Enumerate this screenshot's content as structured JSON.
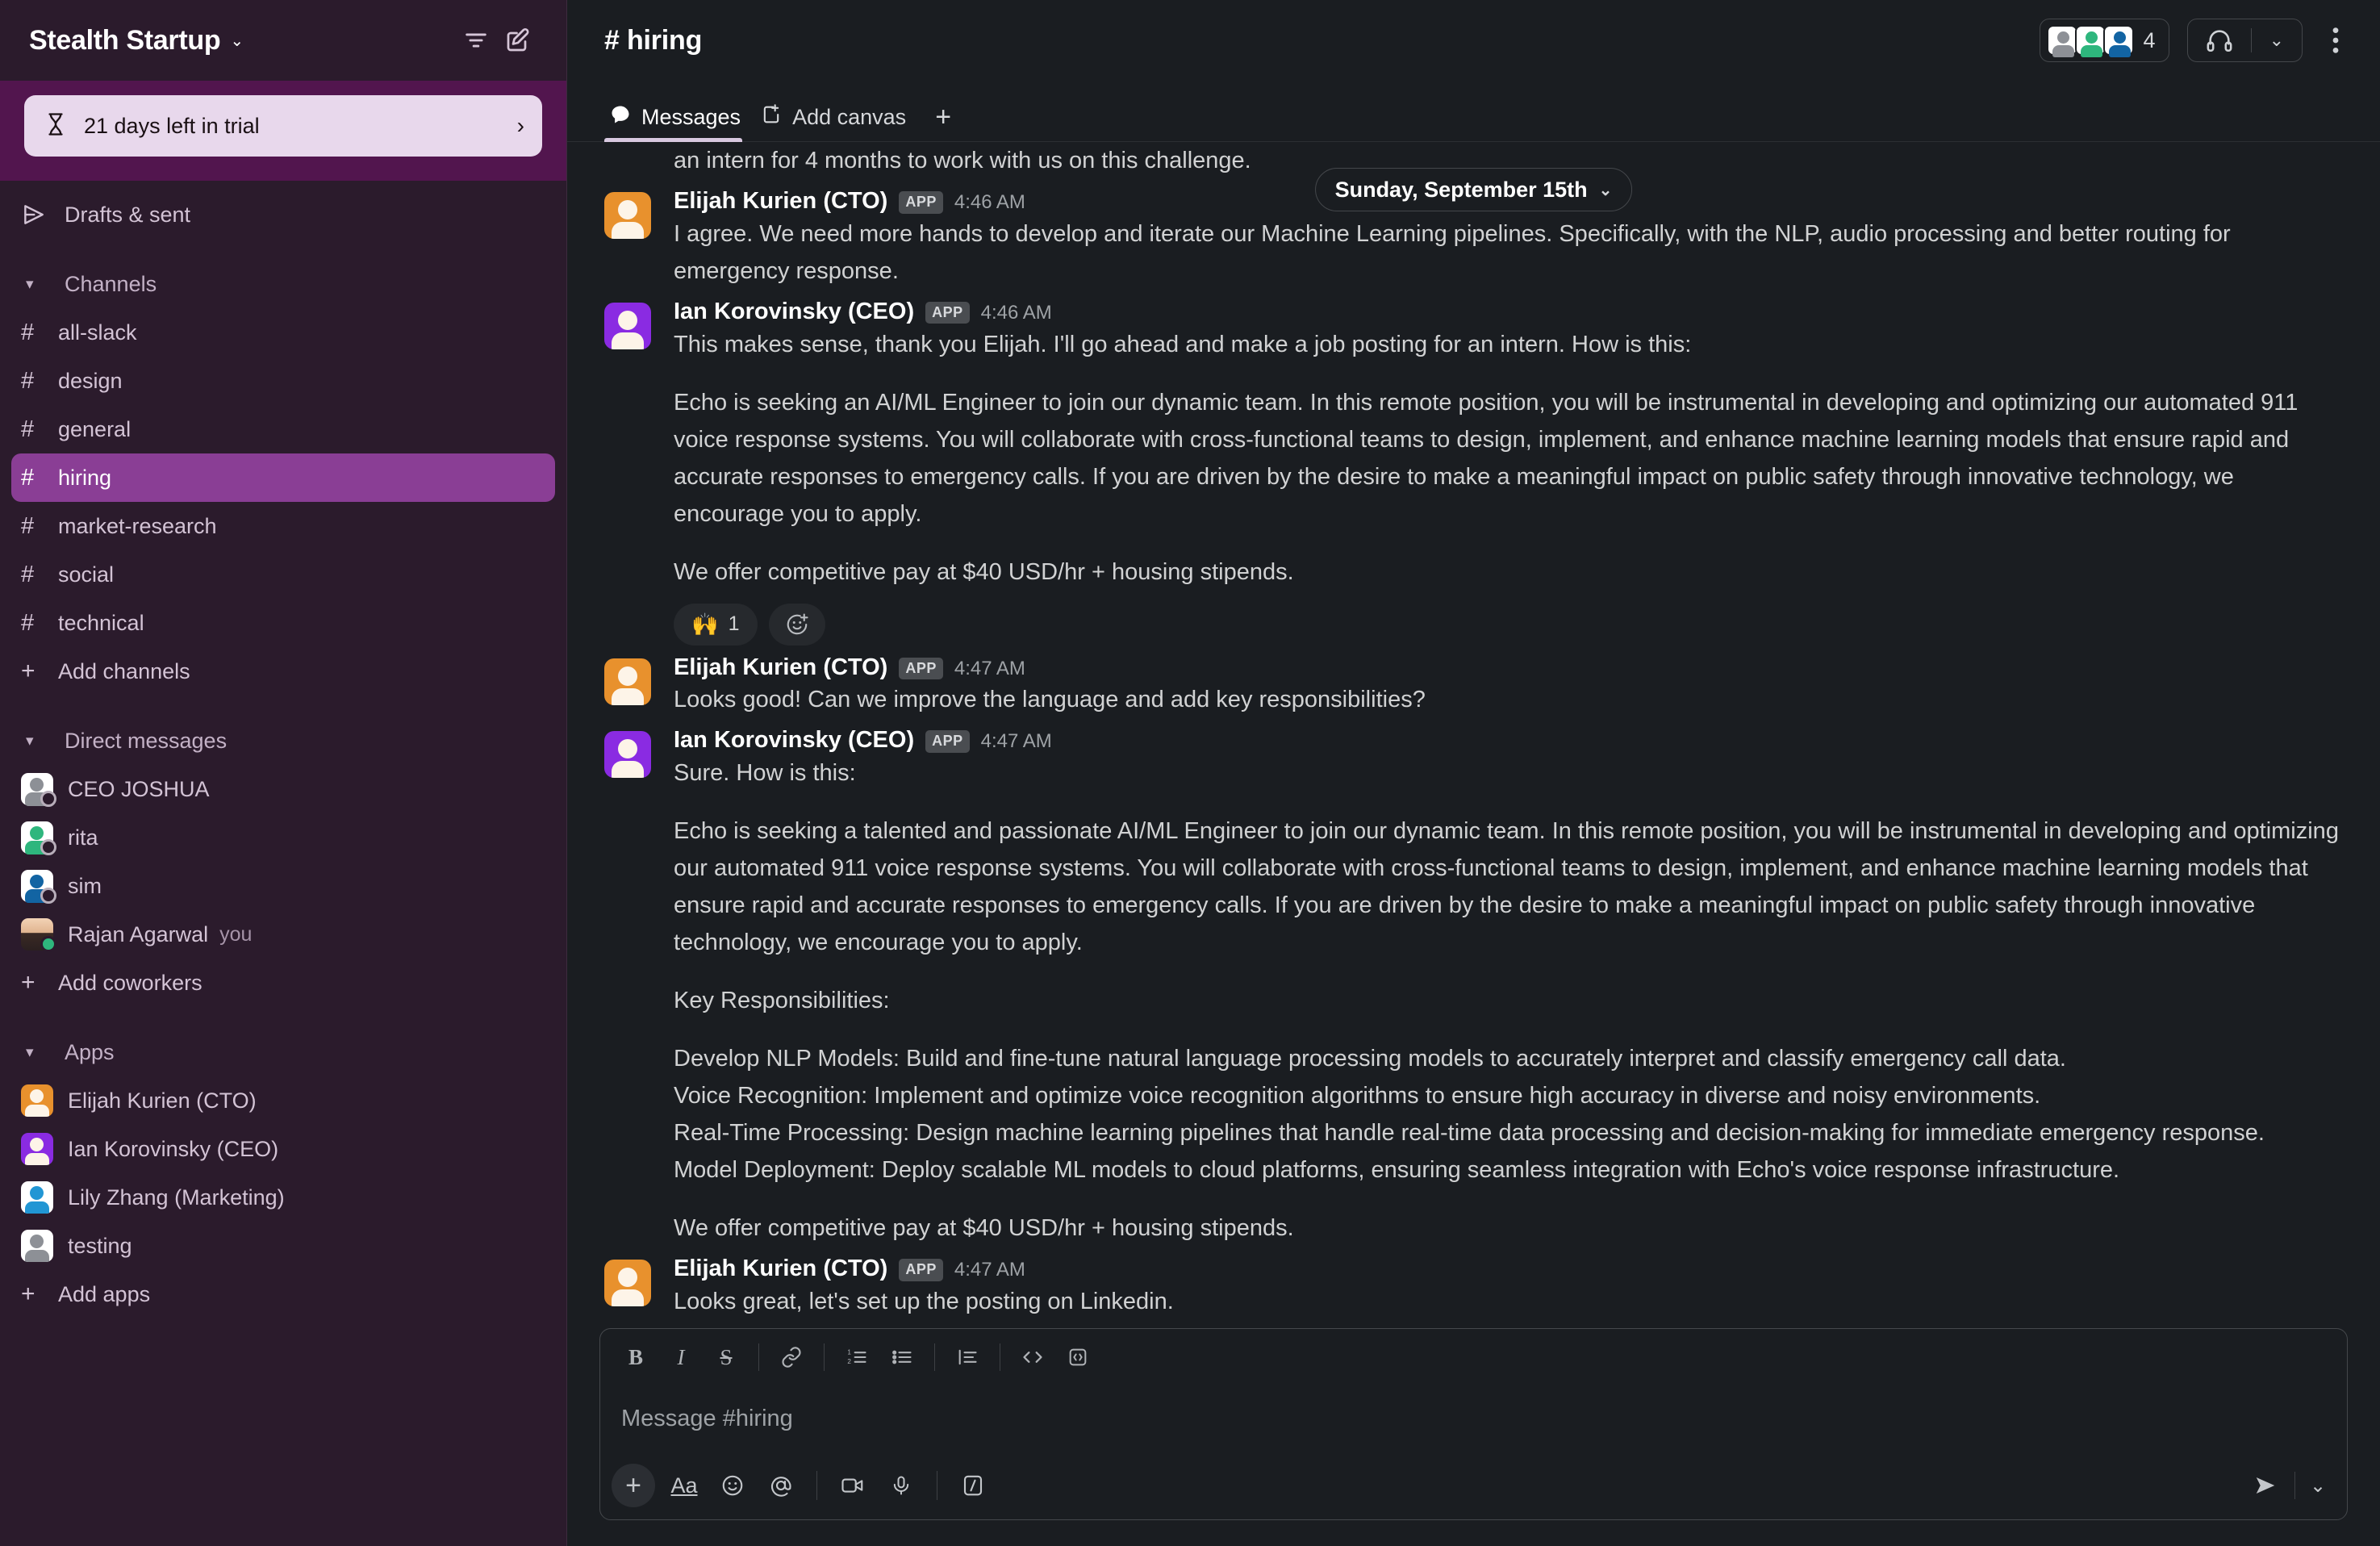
{
  "sidebar": {
    "workspace_name": "Stealth Startup",
    "workspace_caret": "⌄",
    "filter_icon": "filter-icon",
    "compose_icon": "compose-icon",
    "trial": {
      "icon": "hourglass-icon",
      "label": "21 days left in trial",
      "chevron": "›"
    },
    "drafts": {
      "label": "Drafts & sent",
      "icon": "paper-plane-icon"
    },
    "channels_section": {
      "label": "Channels",
      "caret": "▾",
      "items": [
        {
          "name": "all-slack",
          "active": false
        },
        {
          "name": "design",
          "active": false
        },
        {
          "name": "general",
          "active": false
        },
        {
          "name": "hiring",
          "active": true
        },
        {
          "name": "market-research",
          "active": false
        },
        {
          "name": "social",
          "active": false
        },
        {
          "name": "technical",
          "active": false
        }
      ],
      "add_label": "Add channels"
    },
    "dm_section": {
      "label": "Direct messages",
      "caret": "▾",
      "items": [
        {
          "name": "CEO JOSHUA",
          "color": "#8d9096",
          "presence": "away",
          "you": ""
        },
        {
          "name": "rita",
          "color": "#2eb67d",
          "presence": "away",
          "you": ""
        },
        {
          "name": "sim",
          "color": "#1264a3",
          "presence": "away",
          "you": ""
        },
        {
          "name": "Rajan Agarwal",
          "color": "#e8a87c",
          "presence": "online",
          "you": "you"
        }
      ],
      "add_label": "Add coworkers"
    },
    "apps_section": {
      "label": "Apps",
      "caret": "▾",
      "items": [
        {
          "name": "Elijah Kurien (CTO)",
          "color": "#e8912d"
        },
        {
          "name": "Ian Korovinsky (CEO)",
          "color": "#8a2be2"
        },
        {
          "name": "Lily Zhang (Marketing)",
          "color": "#2196d4"
        },
        {
          "name": "testing",
          "color": "#8d9096"
        }
      ],
      "add_label": "Add apps"
    }
  },
  "header": {
    "channel_title": "# hiring",
    "members_count": "4",
    "headphones_icon": "headphones-icon",
    "headphones_caret": "⌄",
    "kebab_icon": "more-options-icon",
    "face_colors": [
      "#8d9096",
      "#2eb67d",
      "#1264a3"
    ]
  },
  "tabs": {
    "items": [
      {
        "label": "Messages",
        "icon": "messages-icon",
        "active": true
      },
      {
        "label": "Add canvas",
        "icon": "canvas-icon",
        "active": false
      }
    ],
    "add_tab": "+"
  },
  "date_divider": {
    "label": "Sunday, September 15th",
    "caret": "⌄"
  },
  "scrolled_message_tail": "an intern for 4 months to work with us on this challenge.",
  "messages": [
    {
      "author": "Elijah Kurien (CTO)",
      "badge": "APP",
      "time": "4:46 AM",
      "avatar_color": "#e8912d",
      "paragraphs": [
        "I agree. We need more hands to develop and iterate our Machine Learning pipelines. Specifically, with the NLP, audio processing and better routing for emergency response."
      ],
      "reactions": []
    },
    {
      "author": "Ian Korovinsky (CEO)",
      "badge": "APP",
      "time": "4:46 AM",
      "avatar_color": "#8a2be2",
      "paragraphs": [
        "This makes sense, thank you Elijah. I'll go ahead and make a job posting for an intern. How is this:",
        "Echo is seeking an AI/ML Engineer to join our dynamic team. In this remote position, you will be instrumental in developing and optimizing our automated 911 voice response systems. You will collaborate with cross-functional teams to design, implement, and enhance machine learning models that ensure rapid and accurate responses to emergency calls. If you are driven by the desire to make a meaningful impact on public safety through innovative technology, we encourage you to apply.",
        "We offer competitive pay at $40 USD/hr + housing stipends."
      ],
      "reactions": [
        {
          "emoji": "🙌",
          "count": "1"
        }
      ],
      "add_reaction_icon": "add-reaction-icon"
    },
    {
      "author": "Elijah Kurien (CTO)",
      "badge": "APP",
      "time": "4:47 AM",
      "avatar_color": "#e8912d",
      "paragraphs": [
        "Looks good! Can we improve the language and add key responsibilities?"
      ],
      "reactions": []
    },
    {
      "author": "Ian Korovinsky (CEO)",
      "badge": "APP",
      "time": "4:47 AM",
      "avatar_color": "#8a2be2",
      "paragraphs": [
        "Sure. How is this:",
        "Echo is seeking a talented and passionate AI/ML Engineer to join our dynamic team. In this remote position, you will be instrumental in developing and optimizing our automated 911 voice response systems. You will collaborate with cross-functional teams to design, implement, and enhance machine learning models that ensure rapid and accurate responses to emergency calls. If you are driven by the desire to make a meaningful impact on public safety through innovative technology, we encourage you to apply.",
        "Key Responsibilities:"
      ],
      "responsibilities": [
        "Develop NLP Models: Build and fine-tune natural language processing models to accurately interpret and classify emergency call data.",
        "Voice Recognition: Implement and optimize voice recognition algorithms to ensure high accuracy in diverse and noisy environments.",
        "Real-Time Processing: Design machine learning pipelines that handle real-time data processing and decision-making for immediate emergency response.",
        "Model Deployment: Deploy scalable ML models to cloud platforms, ensuring seamless integration with Echo's voice response infrastructure."
      ],
      "closing": "We offer competitive pay at $40 USD/hr + housing stipends.",
      "reactions": []
    },
    {
      "author": "Elijah Kurien (CTO)",
      "badge": "APP",
      "time": "4:47 AM",
      "avatar_color": "#e8912d",
      "paragraphs": [
        "Looks great, let's set up the posting on Linkedin."
      ],
      "reactions": []
    }
  ],
  "composer": {
    "placeholder": "Message #hiring",
    "format_buttons": [
      {
        "name": "bold",
        "glyph": "B"
      },
      {
        "name": "italic",
        "glyph": "I"
      },
      {
        "name": "strikethrough",
        "glyph": "S"
      },
      {
        "name": "link",
        "glyph": "🔗"
      },
      {
        "name": "ordered-list",
        "glyph": "≣"
      },
      {
        "name": "bulleted-list",
        "glyph": "☰"
      },
      {
        "name": "blockquote",
        "glyph": "≡"
      },
      {
        "name": "code",
        "glyph": "‹›"
      },
      {
        "name": "code-block",
        "glyph": "⌨"
      }
    ],
    "action_buttons": [
      {
        "name": "plus",
        "glyph": "+"
      },
      {
        "name": "formatting",
        "glyph": "Aa"
      },
      {
        "name": "emoji",
        "glyph": "☺"
      },
      {
        "name": "mention",
        "glyph": "@"
      },
      {
        "name": "video",
        "glyph": "▭"
      },
      {
        "name": "audio",
        "glyph": "ᴘ"
      },
      {
        "name": "slash-command",
        "glyph": "/"
      }
    ],
    "send_glyph": "➤",
    "send_caret": "⌄"
  },
  "colors": {
    "sidebar_bg": "#2b1b2c",
    "trial_bg": "#52154e",
    "active_channel": "#8a3e95",
    "main_bg": "#1a1d21",
    "accent": "#d8c9e0"
  }
}
